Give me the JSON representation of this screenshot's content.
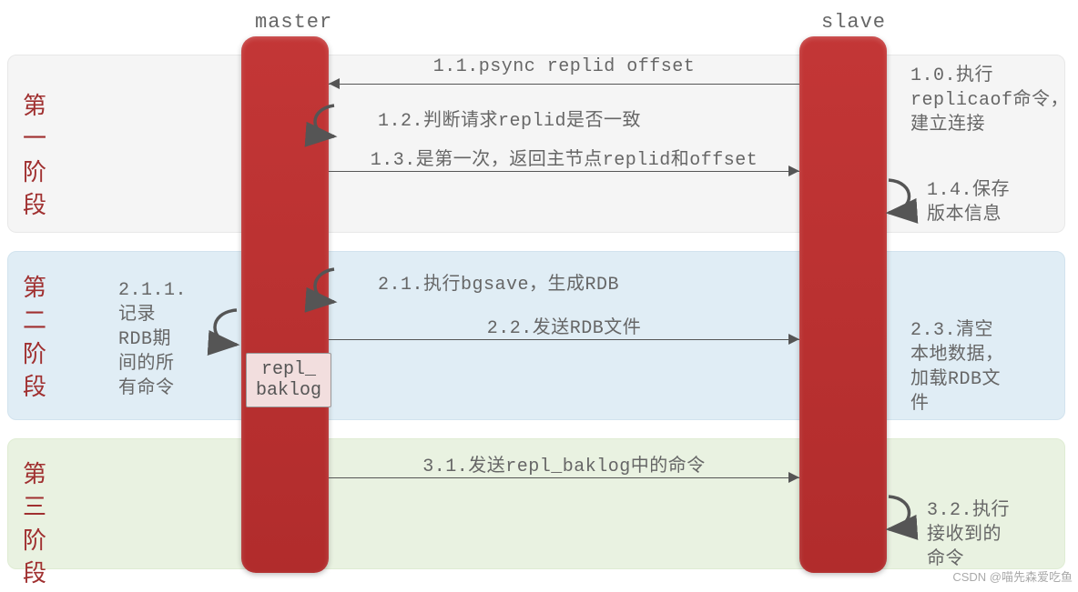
{
  "actors": {
    "master": "master",
    "slave": "slave"
  },
  "phases": {
    "p1": "第一阶段",
    "p2": "第二阶段",
    "p3": "第三阶段"
  },
  "messages": {
    "m11": "1.1.psync replid offset",
    "m12": "1.2.判断请求replid是否一致",
    "m13": "1.3.是第一次，返回主节点replid和offset",
    "m21": "2.1.执行bgsave，生成RDB",
    "m22": "2.2.发送RDB文件",
    "m31": "3.1.发送repl_baklog中的命令"
  },
  "notes": {
    "n10": "1.0.执行\nreplicaof命令，\n建立连接",
    "n14": "1.4.保存\n版本信息",
    "n211": "2.1.1.\n记录\nRDB期\n间的所\n有命令",
    "n23": "2.3.清空\n本地数据，\n加载RDB文\n件",
    "n32": "3.2.执行\n接收到的\n命令",
    "repl_baklog": "repl_\nbaklog"
  },
  "watermark": "CSDN @喵先森爱吃鱼"
}
